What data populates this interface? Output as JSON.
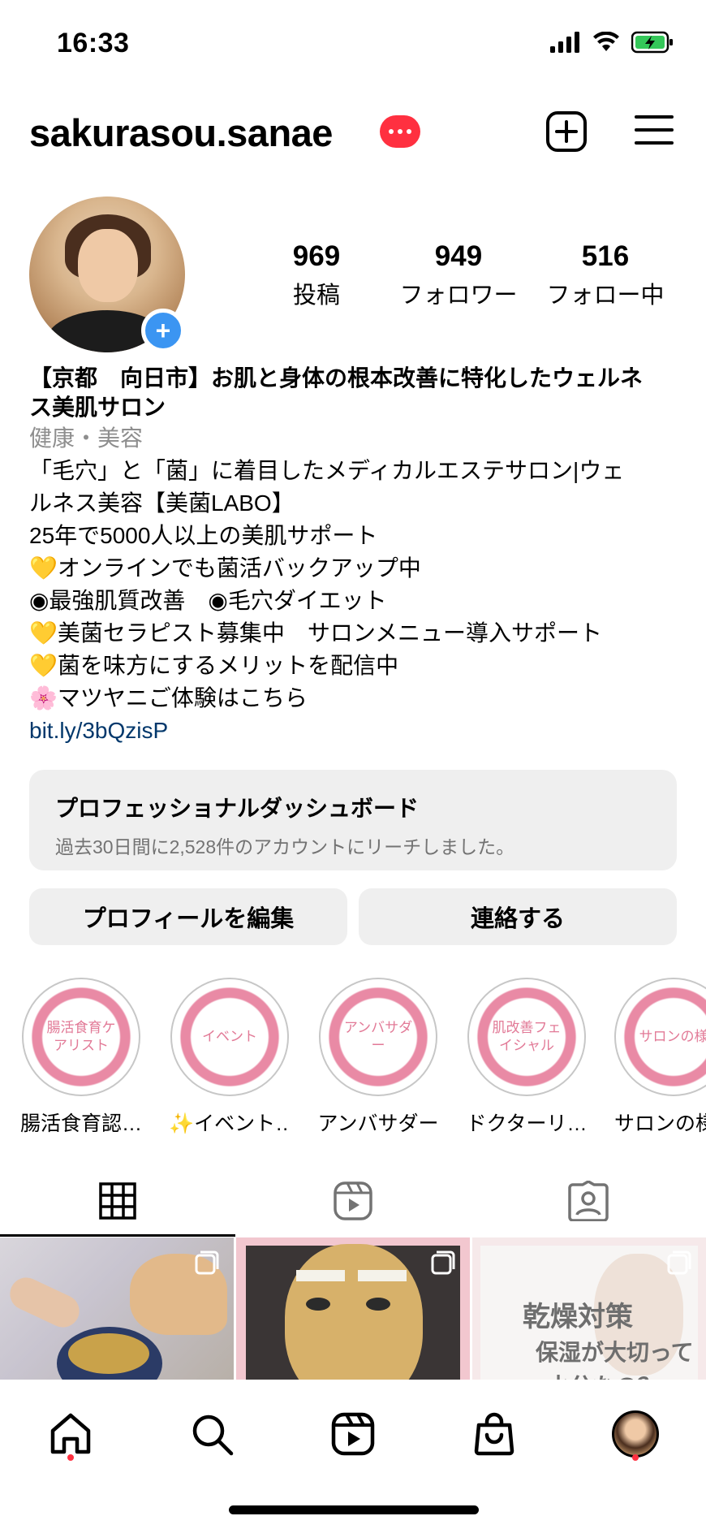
{
  "status_bar": {
    "time": "16:33"
  },
  "header": {
    "username": "sakurasou.sanae"
  },
  "stats": [
    {
      "value": "969",
      "label": "投稿"
    },
    {
      "value": "949",
      "label": "フォロワー"
    },
    {
      "value": "516",
      "label": "フォロー中"
    }
  ],
  "bio": {
    "name_line1": "【京都　向日市】お肌と身体の根本改善に特化したウェルネ",
    "name_line2": "ス美肌サロン",
    "category": "健康・美容",
    "lines": [
      "「毛穴」と「菌」に着目したメディカルエステサロン|ウェ",
      "ルネス美容【美菌LABO】",
      "25年で5000人以上の美肌サポート",
      "💛オンラインでも菌活バックアップ中",
      "◉最強肌質改善　◉毛穴ダイエット",
      "💛美菌セラピスト募集中　サロンメニュー導入サポート",
      "💛菌を味方にするメリットを配信中",
      "🌸マツヤニご体験はこちら"
    ],
    "link": "bit.ly/3bQzisP"
  },
  "dashboard": {
    "title": "プロフェッショナルダッシュボード",
    "subtitle": "過去30日間に2,528件のアカウントにリーチしました。"
  },
  "buttons": {
    "edit_profile": "プロフィールを編集",
    "contact": "連絡する"
  },
  "highlights": [
    {
      "cover": "腸活食育ケアリスト",
      "label": "腸活食育認…"
    },
    {
      "cover": "イベント",
      "label": "✨イベント…"
    },
    {
      "cover": "アンバサダー",
      "label": "アンバサダー"
    },
    {
      "cover": "肌改善フェイシャル",
      "label": "ドクターリ…"
    },
    {
      "cover": "サロンの様",
      "label": "サロンの様"
    }
  ],
  "posts": [
    {
      "text": ""
    },
    {
      "text": ""
    },
    {
      "line1": "乾燥対策",
      "line2": "保湿が大切って",
      "line3": "水分なの？"
    }
  ],
  "colors": {
    "accent_red": "#ff3040",
    "link_blue": "#00376b",
    "avatar_add_blue": "#3b95f2",
    "highlight_pink": "#e98aa5"
  },
  "icons": {
    "header": [
      "add-post-icon",
      "menu-icon"
    ],
    "tabs": [
      "grid-icon",
      "reels-icon",
      "tagged-icon"
    ],
    "nav": [
      "home-icon",
      "search-icon",
      "reels-icon",
      "shop-icon",
      "profile-avatar"
    ]
  }
}
